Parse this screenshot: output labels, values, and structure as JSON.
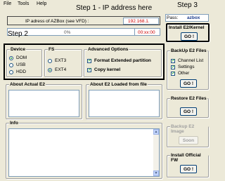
{
  "menu": {
    "file": "File",
    "tools": "Tools",
    "help": "Help"
  },
  "ip": {
    "label": "IP adress of AZBox (see VFD) :",
    "value": "192.168.1."
  },
  "pass": {
    "label": "Pass:",
    "value": "azbox"
  },
  "progress": {
    "text": "0%",
    "fraction": 0.0,
    "timer": "00:xx:00"
  },
  "device": {
    "title": "Device",
    "options": [
      "DOM",
      "USB",
      "HDD"
    ],
    "selected": "DOM"
  },
  "fs": {
    "title": "FS",
    "options": [
      "EXT3",
      "EXT4"
    ],
    "selected": "EXT4"
  },
  "advanced": {
    "title": "Advanced Options",
    "options": [
      "Format Extended partition",
      "Copy kernel"
    ]
  },
  "about_actual": {
    "title": "About Actual E2"
  },
  "about_loaded": {
    "title": "About E2 Loaded from file"
  },
  "info": {
    "title": "Info"
  },
  "install_kernel": {
    "title": "Install E2/Kernel",
    "button": "GO !"
  },
  "backup_files": {
    "title": "BackUp E2 Files",
    "options": [
      "Channel List",
      "Settings",
      "Other"
    ],
    "button": "GO !"
  },
  "restore_files": {
    "title": "Restore E2 Files",
    "button": "GO !"
  },
  "backup_image": {
    "title": "Backup E2 Image",
    "button": "Soon"
  },
  "install_fw": {
    "title": "Install Official FW",
    "button": "GO !"
  },
  "annotations": {
    "step1": "Step 1 - IP address here",
    "step2": "Step 2",
    "step3": "Step 3"
  },
  "colors": {
    "annotation_box": "#000000",
    "ip_value": "#cc0000",
    "timer": "#cc0000"
  }
}
